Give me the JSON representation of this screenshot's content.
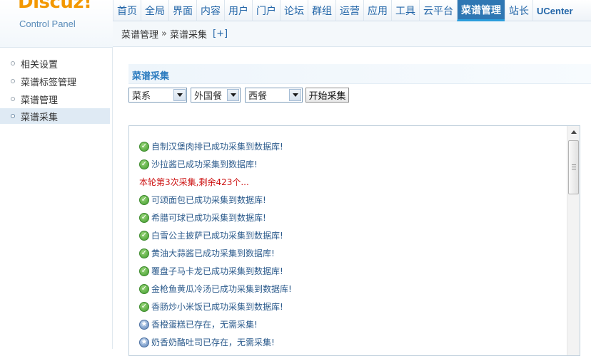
{
  "logo": {
    "brand": "Discuz!",
    "subtitle": "Control Panel"
  },
  "topnav": [
    {
      "label": "首页"
    },
    {
      "label": "全局"
    },
    {
      "label": "界面"
    },
    {
      "label": "内容"
    },
    {
      "label": "用户"
    },
    {
      "label": "门户"
    },
    {
      "label": "论坛"
    },
    {
      "label": "群组"
    },
    {
      "label": "运营"
    },
    {
      "label": "应用"
    },
    {
      "label": "工具"
    },
    {
      "label": "云平台"
    },
    {
      "label": "菜谱管理"
    },
    {
      "label": "站长"
    },
    {
      "label": "UCenter"
    }
  ],
  "breadcrumb": {
    "parent": "菜谱管理",
    "separator": "»",
    "current": "菜谱采集",
    "add": "[+]"
  },
  "sidebar": {
    "items": [
      {
        "label": "相关设置"
      },
      {
        "label": "菜谱标签管理"
      },
      {
        "label": "菜谱管理"
      },
      {
        "label": "菜谱采集"
      }
    ]
  },
  "main": {
    "title": "菜谱采集",
    "filters": {
      "category": "菜系",
      "cuisine": "外国餐",
      "style": "西餐"
    },
    "start_button": "开始采集",
    "log": [
      {
        "type": "ok",
        "text": "自制汉堡肉排已成功采集到数据库!"
      },
      {
        "type": "ok",
        "text": "沙拉酱已成功采集到数据库!"
      },
      {
        "type": "warn",
        "text": "本轮第3次采集,剩余423个..."
      },
      {
        "type": "ok",
        "text": "可颂面包已成功采集到数据库!"
      },
      {
        "type": "ok",
        "text": "希腊可球已成功采集到数据库!"
      },
      {
        "type": "ok",
        "text": "白雪公主披萨已成功采集到数据库!"
      },
      {
        "type": "ok",
        "text": "黄油大蒜酱已成功采集到数据库!"
      },
      {
        "type": "ok",
        "text": "覆盘子马卡龙已成功采集到数据库!"
      },
      {
        "type": "ok",
        "text": "金枪鱼黄瓜冷汤已成功采集到数据库!"
      },
      {
        "type": "ok",
        "text": "香肠炒小米饭已成功采集到数据库!"
      },
      {
        "type": "exists",
        "text": "香橙蛋糕已存在，无需采集!"
      },
      {
        "type": "exists",
        "text": "奶香奶酪吐司已存在，无需采集!"
      }
    ]
  },
  "colors": {
    "brand_orange": "#f39800",
    "nav_active": "#2f77b3",
    "link_blue": "#2c5b8c",
    "warn_red": "#cc1010"
  }
}
